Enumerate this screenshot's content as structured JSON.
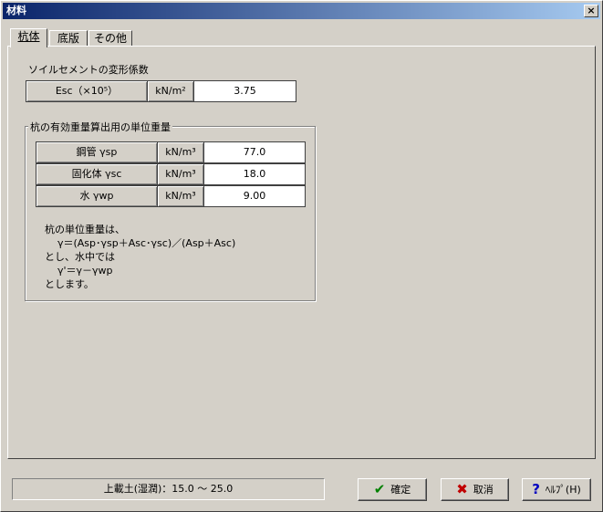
{
  "window": {
    "title": "材料",
    "close_label": "×"
  },
  "tabs": [
    {
      "label": "杭体"
    },
    {
      "label": "底版"
    },
    {
      "label": "その他"
    }
  ],
  "soil_cement": {
    "label": "ソイルセメントの変形係数",
    "name": "Esc（×10⁵）",
    "unit": "kN/m²",
    "value": "3.75"
  },
  "unit_weight": {
    "group_title": "杭の有効重量算出用の単位重量",
    "rows": [
      {
        "name": "鋼管 γsp",
        "unit": "kN/m³",
        "value": "77.0"
      },
      {
        "name": "固化体 γsc",
        "unit": "kN/m³",
        "value": "18.0"
      },
      {
        "name": "水 γwp",
        "unit": "kN/m³",
        "value": "9.00"
      }
    ],
    "note": [
      "杭の単位重量は、",
      "    γ＝(Asp･γsp＋Asc･γsc)／(Asp＋Asc)",
      "とし、水中では",
      "    γ'＝γ－γwp",
      "とします。"
    ]
  },
  "status_text": "上載土(湿潤)：15.0 ～ 25.0",
  "buttons": {
    "ok_label": "確定",
    "cancel_label": "取消",
    "help_label": "ﾍﾙﾌﾟ(H)"
  },
  "colors": {
    "ok_icon": "#008000",
    "cancel_icon": "#c00000",
    "help_icon": "#0000c0"
  }
}
